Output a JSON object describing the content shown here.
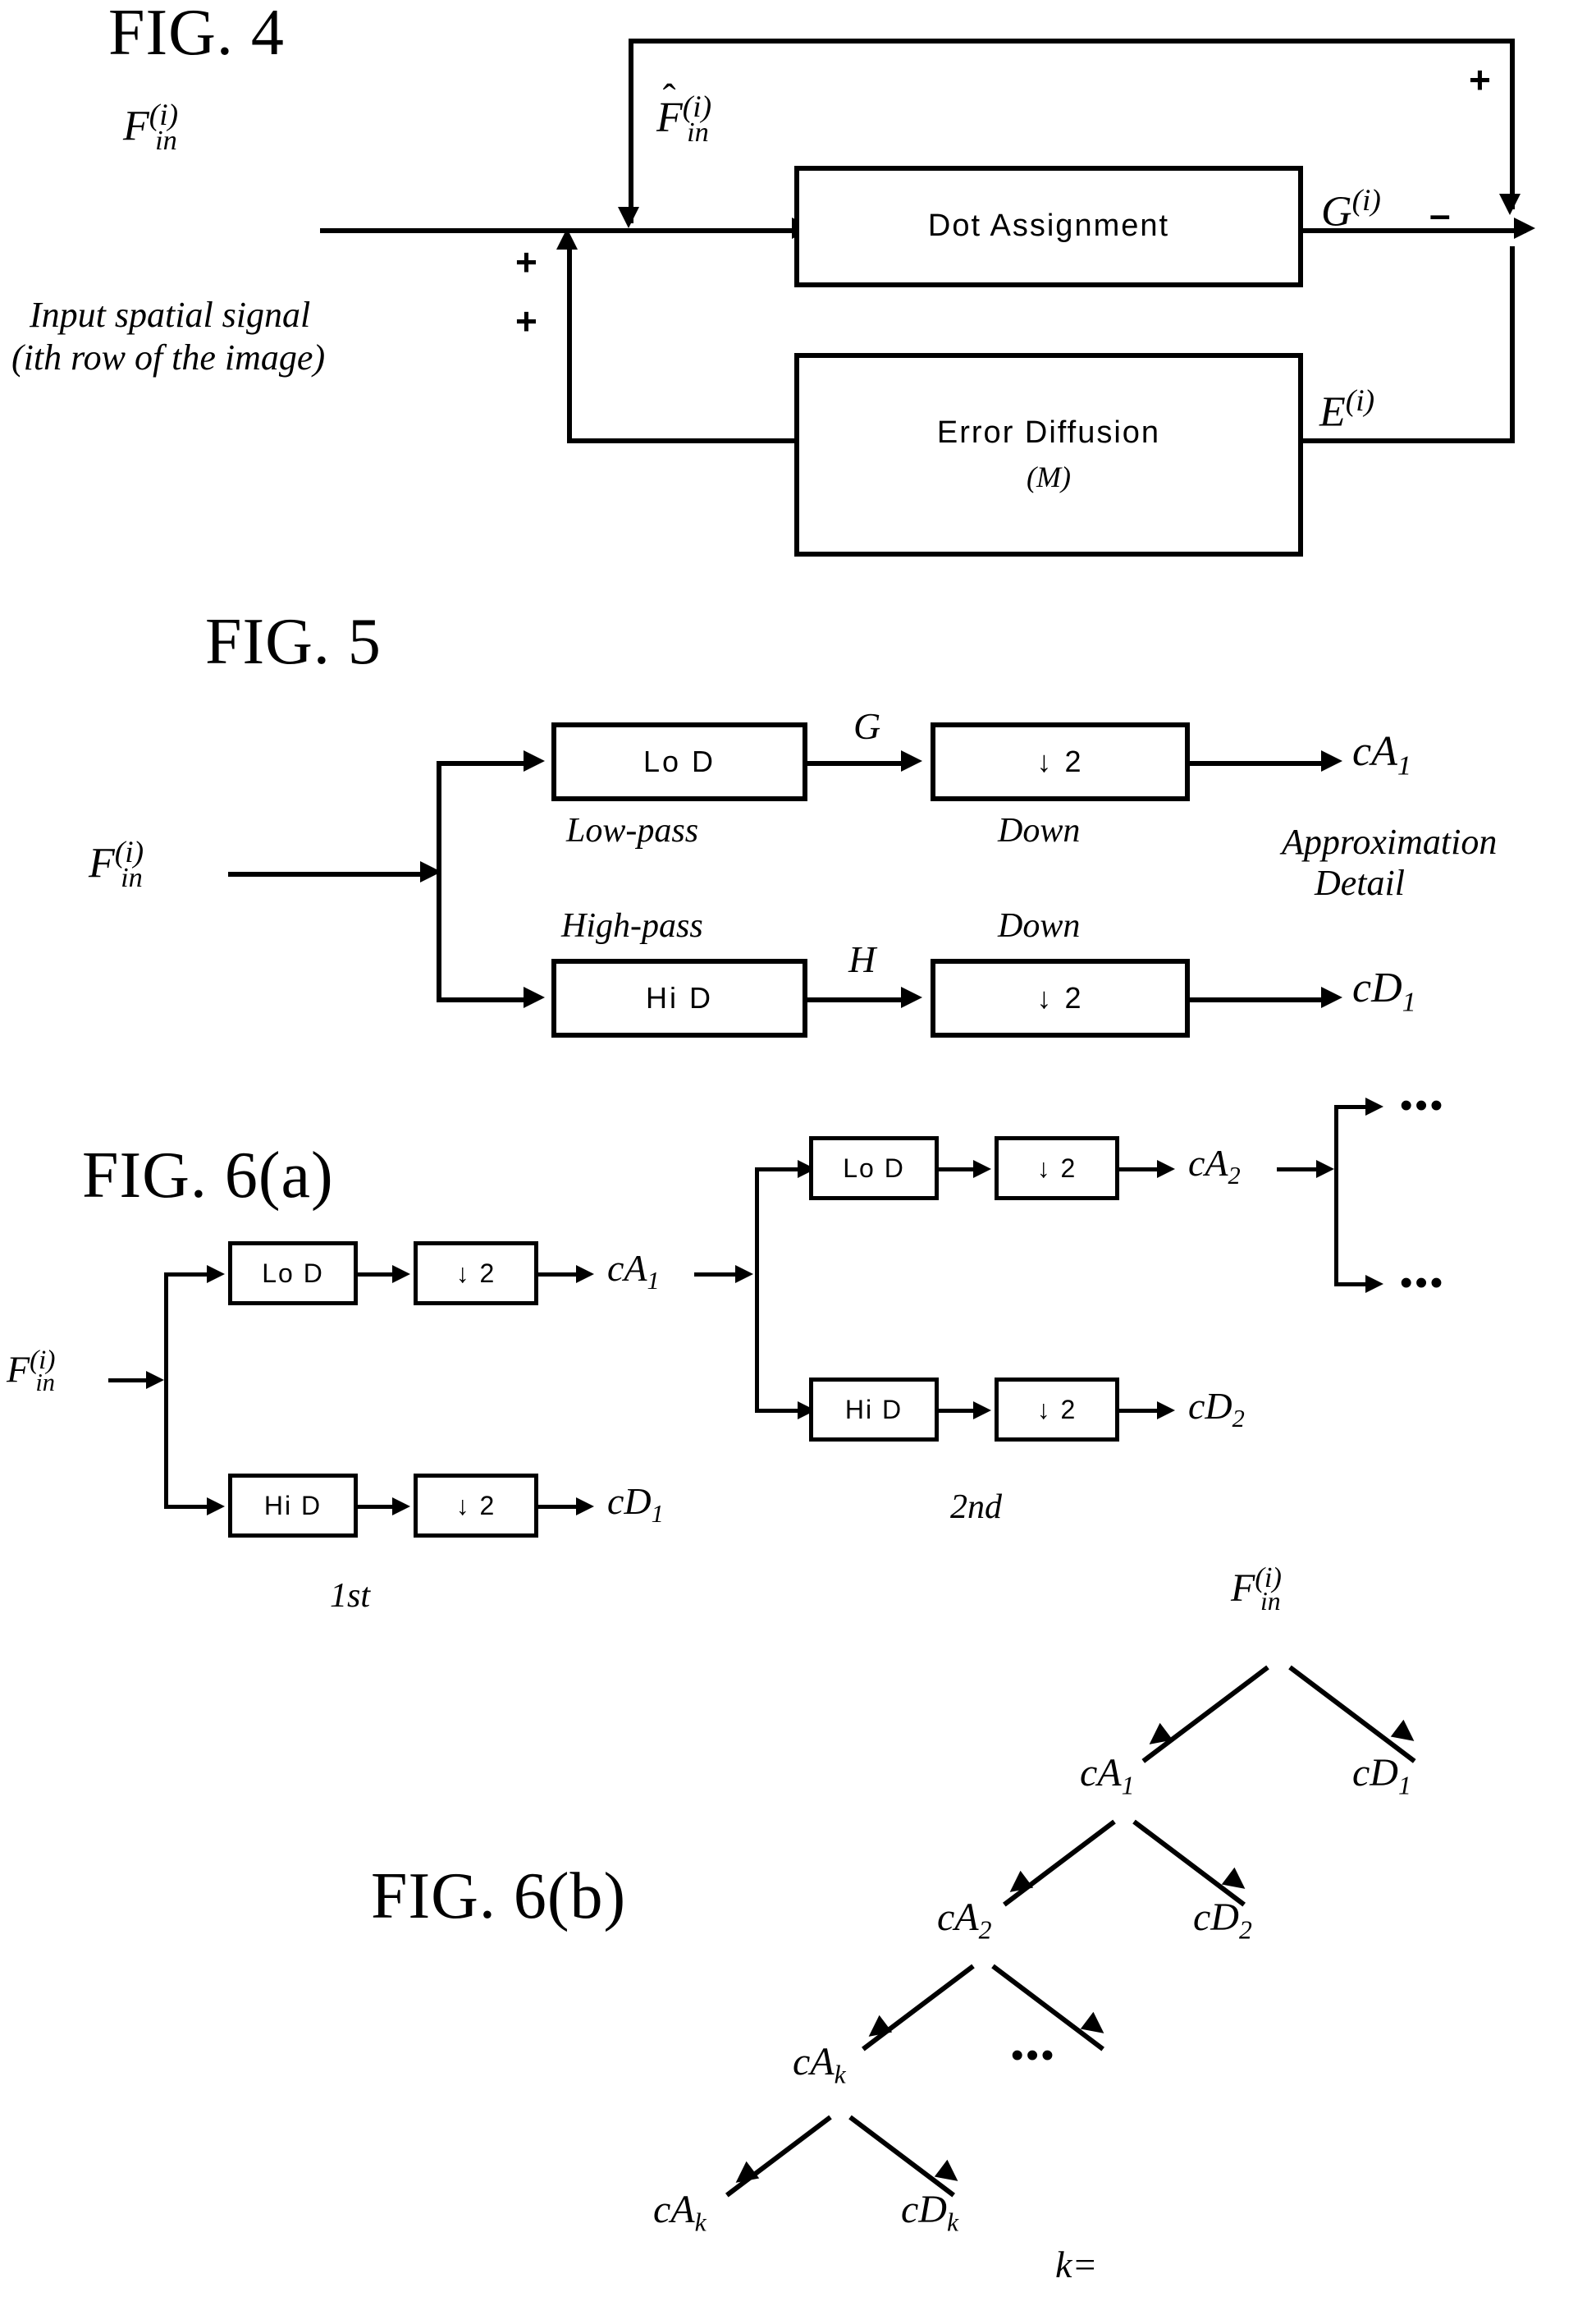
{
  "figures": [
    {
      "id": "fig4",
      "title": "FIG. 4",
      "caption_line1": "Input spatial signal",
      "caption_line2": "(ith row of the image)",
      "input_label": {
        "base": "F",
        "sub": "in",
        "sup": "(i)"
      },
      "hat_label": {
        "base": "F",
        "sub": "in",
        "sup": "(i)",
        "hat": "ˆ"
      },
      "boxes": [
        {
          "name": "dot-assignment",
          "label": "Dot Assignment"
        },
        {
          "name": "error-diffusion",
          "label": "Error Diffusion",
          "sublabel": "(M)"
        }
      ],
      "signals": [
        {
          "name": "g-output",
          "base": "G",
          "sup": "(i)"
        },
        {
          "name": "e-output",
          "base": "E",
          "sup": "(i)"
        }
      ],
      "signs": {
        "plus1": "+",
        "plus2": "+",
        "plus_top": "+",
        "minus": "–"
      }
    },
    {
      "id": "fig5",
      "title": "FIG. 5",
      "input_label": {
        "base": "F",
        "sub": "in",
        "sup": "(i)"
      },
      "branches": [
        {
          "name": "low-pass-branch",
          "filter_box": "Lo  D",
          "filter_caption": "Low-pass",
          "mid_signal": "G",
          "down_box": "↓ 2",
          "down_caption": "Down",
          "output": {
            "base": "cA",
            "sub": "1"
          }
        },
        {
          "name": "high-pass-branch",
          "filter_box": "Hi  D",
          "filter_caption": "High-pass",
          "mid_signal": "H",
          "down_box": "↓ 2",
          "down_caption": "Down",
          "output": {
            "base": "cD",
            "sub": "1"
          }
        }
      ],
      "legend": {
        "line1": "Approximation",
        "line2": "Detail"
      }
    },
    {
      "id": "fig6a",
      "title": "FIG. 6(a)",
      "input_label": {
        "base": "F",
        "sub": "in",
        "sup": "(i)"
      },
      "stages": [
        {
          "name": "stage-1",
          "caption": "1st",
          "rows": [
            {
              "filter": "Lo  D",
              "down": "↓ 2",
              "output": {
                "base": "cA",
                "sub": "1"
              }
            },
            {
              "filter": "Hi  D",
              "down": "↓ 2",
              "output": {
                "base": "cD",
                "sub": "1"
              }
            }
          ]
        },
        {
          "name": "stage-2",
          "caption": "2nd",
          "rows": [
            {
              "filter": "Lo  D",
              "down": "↓ 2",
              "output": {
                "base": "cA",
                "sub": "2"
              }
            },
            {
              "filter": "Hi  D",
              "down": "↓ 2",
              "output": {
                "base": "cD",
                "sub": "2"
              }
            }
          ]
        }
      ],
      "continuation": {
        "top": "•••",
        "bottom": "•••"
      }
    },
    {
      "id": "fig6b",
      "title": "FIG. 6(b)",
      "tree": {
        "root": {
          "base": "F",
          "sub": "in",
          "sup": "(i)"
        },
        "levels": [
          {
            "left": {
              "base": "cA",
              "sub": "1"
            },
            "right": {
              "base": "cD",
              "sub": "1"
            }
          },
          {
            "left": {
              "base": "cA",
              "sub": "2"
            },
            "right": {
              "base": "cD",
              "sub": "2"
            }
          },
          {
            "ellipsis": "•••",
            "node": {
              "base": "cA",
              "sub": "k"
            }
          },
          {
            "left": {
              "base": "cA",
              "sub": "k"
            },
            "right": {
              "base": "cD",
              "sub": "k"
            }
          }
        ],
        "annotation": "k="
      }
    }
  ],
  "colors": {
    "ink": "#000000",
    "paper": "#ffffff"
  }
}
